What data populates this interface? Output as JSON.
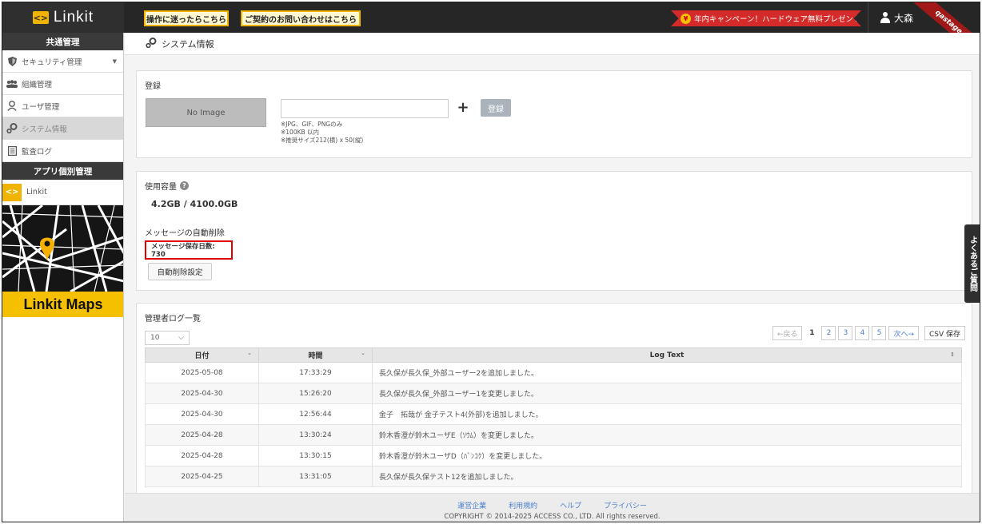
{
  "header": {
    "logo_text": "Linkit",
    "help_button": "操作に迷ったらこちら",
    "contact_button": "ご契約のお問い合わせはこちら",
    "campaign_text": "年内キャンペーン！ハードウェア無料プレゼント",
    "user_name": "大森",
    "ribbon_text": "qastage"
  },
  "sidebar": {
    "common_heading": "共通管理",
    "items": [
      {
        "label": "セキュリティ管理",
        "icon": "shield-icon"
      },
      {
        "label": "組織管理",
        "icon": "users-icon"
      },
      {
        "label": "ユーザ管理",
        "icon": "user-icon"
      },
      {
        "label": "システム情報",
        "icon": "gears-icon",
        "active": true
      },
      {
        "label": "監査ログ",
        "icon": "log-icon"
      }
    ],
    "app_heading": "アプリ個別管理",
    "app_item": "Linkit",
    "banner_label": "Linkit Maps"
  },
  "page": {
    "title": "システム情報"
  },
  "registration": {
    "title": "登録",
    "no_image": "No Image",
    "plus": "+",
    "register_button": "登録",
    "notes": [
      "※JPG、GIF、PNGのみ",
      "※100KB 以内",
      "※推奨サイズ212(横) x 50(縦)"
    ]
  },
  "usage": {
    "title": "使用容量",
    "value": "4.2GB / 4100.0GB",
    "autodelete_title": "メッセージの自動削除",
    "retention_label": "メッセージ保存日数: 730",
    "autodelete_button": "自動削除設定"
  },
  "logs": {
    "title": "管理者ログ一覧",
    "page_size": "10",
    "pager": {
      "prev": "←戻る",
      "pages": [
        "1",
        "2",
        "3",
        "4",
        "5"
      ],
      "next": "次へ→",
      "csv": "CSV 保存"
    },
    "columns": [
      "日付",
      "時間",
      "Log Text"
    ],
    "rows": [
      {
        "date": "2025-05-08",
        "time": "17:33:29",
        "text": "長久保が長久保_外部ユーザー2を追加しました。"
      },
      {
        "date": "2025-04-30",
        "time": "15:26:20",
        "text": "長久保が長久保_外部ユーザー1を変更しました。"
      },
      {
        "date": "2025-04-30",
        "time": "12:56:44",
        "text": "金子　拓哉が 金子テスト4(外部)を追加しました。"
      },
      {
        "date": "2025-04-28",
        "time": "13:30:24",
        "text": "鈴木香澄が鈴木ユーザE（ｿｳﾑ）を変更しました。"
      },
      {
        "date": "2025-04-28",
        "time": "13:30:15",
        "text": "鈴木香澄が鈴木ユーザD（ﾊﾞﾝｺｸ）を変更しました。"
      },
      {
        "date": "2025-04-25",
        "time": "13:31:05",
        "text": "長久保が長久保テスト12を追加しました。"
      }
    ]
  },
  "footer": {
    "links": [
      "運営企業",
      "利用規約",
      "ヘルプ",
      "プライバシー"
    ],
    "copyright": "COPYRIGHT © 2014-2025 ACCESS CO., LTD. All rights reserved."
  },
  "faq_tab": "よくあるご質問",
  "colors": {
    "accent": "#f0b400",
    "topbar": "#262626",
    "campaign": "#d42a2a",
    "link": "#4a7fc8",
    "highlight_border": "#dd0000"
  }
}
